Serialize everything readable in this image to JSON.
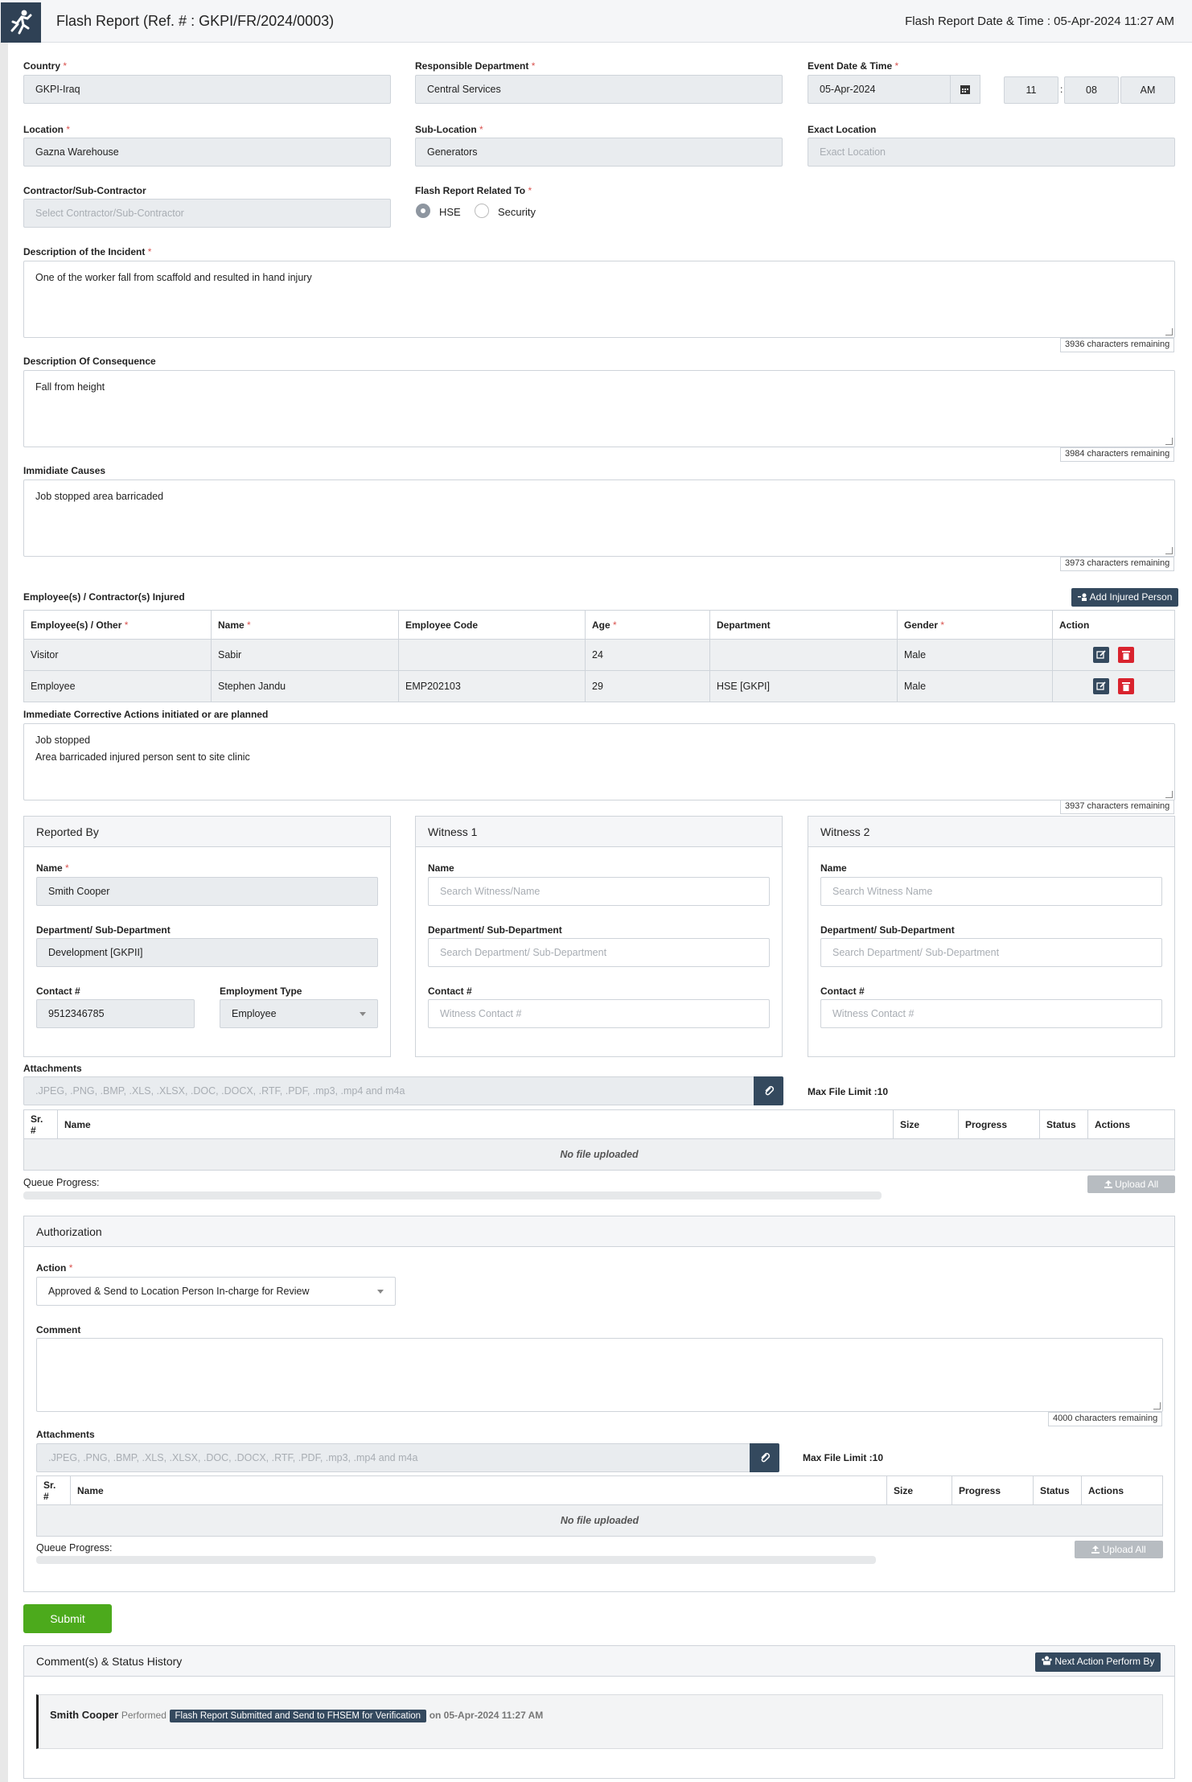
{
  "header": {
    "title": "Flash Report (Ref. # : GKPI/FR/2024/0003)",
    "datetime": "Flash Report Date & Time : 05-Apr-2024 11:27 AM"
  },
  "form": {
    "country_label": "Country",
    "country_value": "GKPI-Iraq",
    "dept_label": "Responsible Department",
    "dept_value": "Central Services",
    "event_label": "Event Date & Time",
    "event_date": "05-Apr-2024",
    "event_hour": "11",
    "event_sep": ":",
    "event_min": "08",
    "event_ampm": "AM",
    "location_label": "Location",
    "location_value": "Gazna Warehouse",
    "sublocation_label": "Sub-Location",
    "sublocation_value": "Generators",
    "exact_label": "Exact Location",
    "exact_placeholder": "Exact Location",
    "contractor_label": "Contractor/Sub-Contractor",
    "contractor_placeholder": "Select Contractor/Sub-Contractor",
    "related_label": "Flash Report Related To",
    "related_opt1": "HSE",
    "related_opt2": "Security",
    "desc_label": "Description of the Incident",
    "desc_value": "One of the worker fall from scaffold and resulted in hand injury",
    "desc_count": "3936 characters remaining",
    "consequence_label": "Description Of Consequence",
    "consequence_value": "Fall from height",
    "consequence_count": "3984 characters remaining",
    "causes_label": "Immidiate Causes",
    "causes_value": "Job stopped area barricaded",
    "causes_count": "3973 characters remaining",
    "req_mark": "*"
  },
  "injured": {
    "label": "Employee(s) / Contractor(s) Injured",
    "add_button": "Add Injured Person",
    "headers": [
      "Employee(s) / Other",
      "Name",
      "Employee Code",
      "Age",
      "Department",
      "Gender",
      "Action"
    ],
    "rows": [
      {
        "type": "Visitor",
        "name": "Sabir",
        "code": "",
        "age": "24",
        "dept": "",
        "gender": "Male"
      },
      {
        "type": "Employee",
        "name": "Stephen Jandu",
        "code": "EMP202103",
        "age": "29",
        "dept": "HSE [GKPI]",
        "gender": "Male"
      }
    ]
  },
  "corrective": {
    "label": "Immediate Corrective Actions initiated or are planned",
    "line1": "Job stopped",
    "line2": "Area barricaded injured person sent to site clinic",
    "count": "3937 characters remaining"
  },
  "reported": {
    "title": "Reported By",
    "name_label": "Name",
    "name_value": "Smith Cooper",
    "dept_label": "Department/ Sub-Department",
    "dept_value": "Development [GKPII]",
    "contact_label": "Contact #",
    "contact_value": "9512346785",
    "emptype_label": "Employment Type",
    "emptype_value": "Employee"
  },
  "witness1": {
    "title": "Witness 1",
    "name_label": "Name",
    "name_placeholder": "Search Witness/Name",
    "dept_label": "Department/ Sub-Department",
    "dept_placeholder": "Search Department/ Sub-Department",
    "contact_label": "Contact #",
    "contact_placeholder": "Witness Contact #"
  },
  "witness2": {
    "title": "Witness 2",
    "name_label": "Name",
    "name_placeholder": "Search Witness Name",
    "dept_label": "Department/ Sub-Department",
    "dept_placeholder": "Search Department/ Sub-Department",
    "contact_label": "Contact #",
    "contact_placeholder": "Witness Contact #"
  },
  "attachments": {
    "label": "Attachments",
    "placeholder": ".JPEG, .PNG, .BMP, .XLS, .XLSX, .DOC, .DOCX, .RTF, .PDF, .mp3, .mp4 and m4a",
    "limit": "Max File Limit :10",
    "headers": [
      "Sr. #",
      "Name",
      "Size",
      "Progress",
      "Status",
      "Actions"
    ],
    "empty": "No file uploaded",
    "queue": "Queue Progress:",
    "upload_all": "Upload All",
    "queue_progress": 0
  },
  "authorization": {
    "title": "Authorization",
    "action_label": "Action",
    "action_value": "Approved & Send to Location Person In-charge for Review",
    "comment_label": "Comment",
    "comment_count": "4000 characters remaining",
    "att_label": "Attachments",
    "att_placeholder": ".JPEG, .PNG, .BMP, .XLS, .XLSX, .DOC, .DOCX, .RTF, .PDF, .mp3, .mp4 and m4a",
    "att_limit": "Max File Limit :10",
    "headers": [
      "Sr. #",
      "Name",
      "Size",
      "Progress",
      "Status",
      "Actions"
    ],
    "empty": "No file uploaded",
    "queue": "Queue Progress:",
    "upload_all": "Upload All",
    "queue_progress": 0
  },
  "submit": "Submit",
  "history": {
    "title": "Comment(s) & Status History",
    "next_button": "Next Action Perform By",
    "user": "Smith Cooper",
    "performed": "Performed",
    "badge": "Flash Report Submitted and Send to FHSEM for Verification",
    "on": "on 05-Apr-2024 11:27 AM"
  },
  "colors": {
    "dark": "#34495e",
    "green": "#4caa1c",
    "red": "#d9232e",
    "required": "#d9534f"
  }
}
